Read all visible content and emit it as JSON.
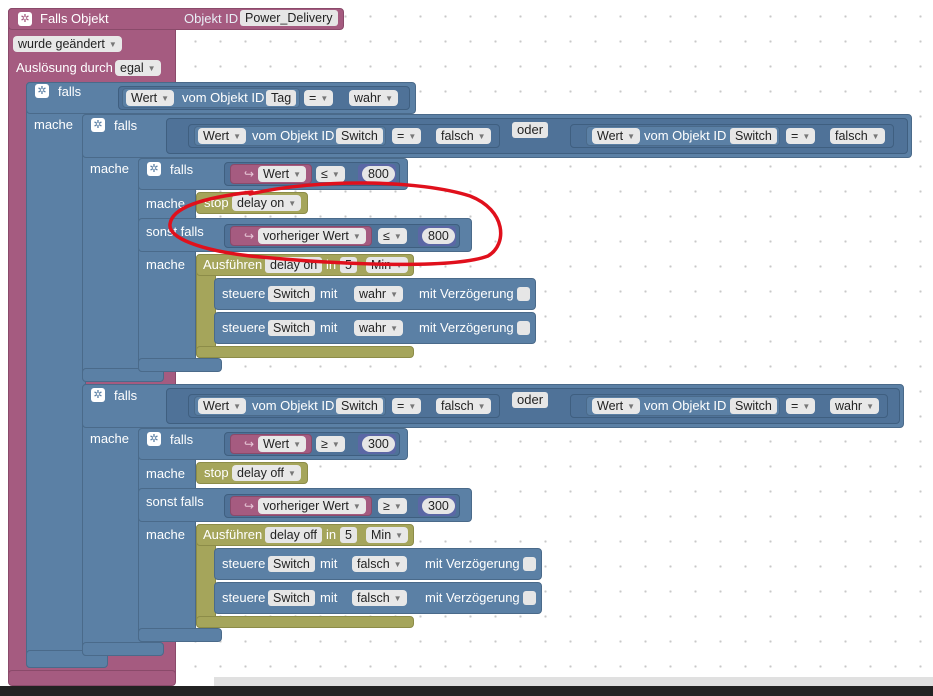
{
  "event": {
    "title": "Falls Objekt",
    "objekt_id_label": "Objekt ID",
    "objekt_id_value": "Power_Delivery",
    "changed": "wurde geändert",
    "trigger_label": "Auslösung durch",
    "trigger_value": "egal"
  },
  "words": {
    "falls": "falls",
    "mache": "mache",
    "sonst_falls": "sonst falls",
    "vom_objekt_id": "vom Objekt ID",
    "oder": "oder",
    "stop": "stop",
    "ausfuehren": "Ausführen",
    "in": "in",
    "steuere": "steuere",
    "mit": "mit",
    "mit_verzoegerung": "mit Verzögerung",
    "wert": "Wert",
    "vorheriger_wert": "vorheriger Wert",
    "tag": "Tag",
    "switch": "Switch",
    "eq": "=",
    "le": "≤",
    "ge": "≥",
    "min": "Min",
    "wahr": "wahr",
    "falsch": "falsch",
    "delay_on": "delay on",
    "delay_off": "delay off"
  },
  "values": {
    "threshold_on": "800",
    "threshold_off": "300",
    "delay_minutes": "5"
  },
  "colors": {
    "event_block": "#a55b80",
    "logic_block": "#5b80a5",
    "timer_block": "#a5a55b",
    "annotation_circle": "#e0101c"
  }
}
